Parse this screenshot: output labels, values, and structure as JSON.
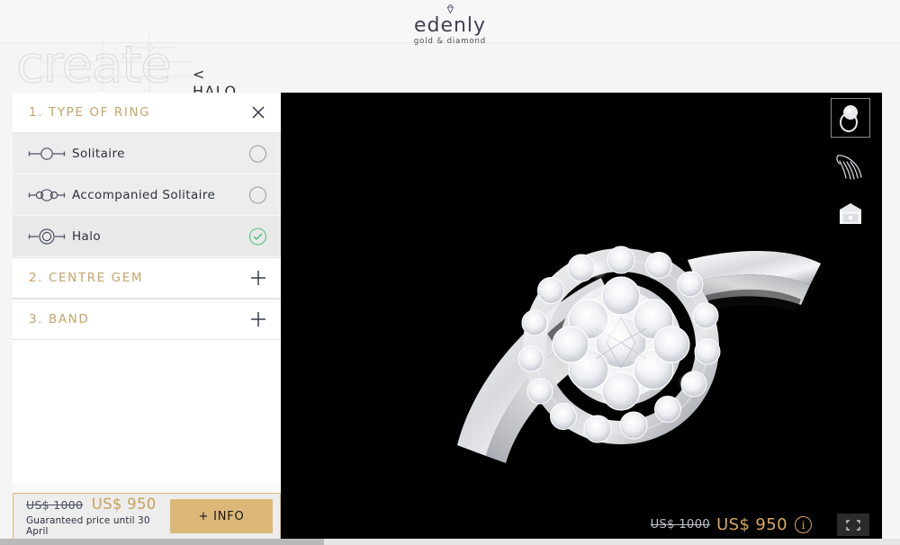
{
  "brand": {
    "name": "edenly",
    "tagline": "gold & diamond",
    "diamond_icon": "diamond-icon"
  },
  "heading": {
    "word": "create",
    "breadcrumb": "< HALO"
  },
  "sidebar": {
    "sections": [
      {
        "number_label": "1. TYPE OF RING",
        "state": "expanded",
        "toggle_icon": "close-icon",
        "options": [
          {
            "label": "Solitaire",
            "icon": "solitaire-ring-icon",
            "selected": false
          },
          {
            "label": "Accompanied Solitaire",
            "icon": "accompanied-solitaire-ring-icon",
            "selected": false
          },
          {
            "label": "Halo",
            "icon": "halo-ring-icon",
            "selected": true
          }
        ]
      },
      {
        "number_label": "2. CENTRE GEM",
        "state": "collapsed",
        "toggle_icon": "plus-icon",
        "options": []
      },
      {
        "number_label": "3. BAND",
        "state": "collapsed",
        "toggle_icon": "plus-icon",
        "options": []
      }
    ]
  },
  "price_panel": {
    "old_price": "US$ 1000",
    "new_price": "US$ 950",
    "guarantee_note": "Guaranteed price until 30 April",
    "info_button": "+ INFO"
  },
  "viewer": {
    "product_alt": "halo-diamond-ring",
    "background": "#000000",
    "view_modes": [
      {
        "name": "ring-view",
        "icon": "ring-thumbnail-icon",
        "active": true
      },
      {
        "name": "hand-view",
        "icon": "hand-icon",
        "active": false
      },
      {
        "name": "box-view",
        "icon": "ring-box-icon",
        "active": false
      }
    ],
    "overlay_price": {
      "old_price": "US$ 1000",
      "new_price": "US$ 950",
      "info_icon": "info-circle-icon"
    },
    "fullscreen_icon": "fullscreen-icon"
  },
  "colors": {
    "accent_gold": "#c6a46b",
    "price_gold": "#c9a158",
    "button_gold": "#dcb878",
    "selected_green": "#4cbf7e",
    "text_dark": "#2d3140",
    "page_bg": "#f5f5f5",
    "row_bg": "#ededed"
  }
}
